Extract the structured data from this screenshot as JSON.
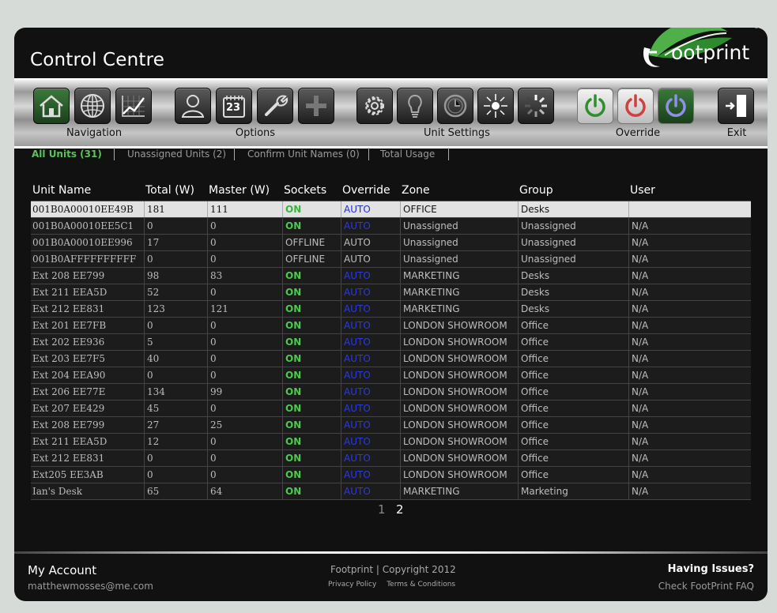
{
  "header": {
    "title": "Control Centre",
    "logo_text": "ootprint"
  },
  "toolbar": {
    "groups": [
      {
        "label": "Navigation"
      },
      {
        "label": "Options",
        "calendar_day": "23"
      },
      {
        "label": "Unit Settings"
      },
      {
        "label": "Override"
      },
      {
        "label": "Exit"
      }
    ]
  },
  "tabs": [
    {
      "label": "All Units (31)"
    },
    {
      "label": "Unassigned Units (2)"
    },
    {
      "label": "Confirm Unit Names (0)"
    },
    {
      "label": "Total Usage"
    }
  ],
  "table": {
    "columns": [
      "Unit Name",
      "Total (W)",
      "Master (W)",
      "Sockets",
      "Override",
      "Zone",
      "Group",
      "User"
    ],
    "rows": [
      [
        "001B0A00010EE49B",
        "181",
        "111",
        "ON",
        "AUTO",
        "OFFICE",
        "Desks",
        ""
      ],
      [
        "001B0A00010EE5C1",
        "0",
        "0",
        "ON",
        "AUTO",
        "Unassigned",
        "Unassigned",
        "N/A"
      ],
      [
        "001B0A00010EE996",
        "17",
        "0",
        "OFFLINE",
        "AUTO",
        "Unassigned",
        "Unassigned",
        "N/A"
      ],
      [
        "001B0AFFFFFFFFFF",
        "0",
        "0",
        "OFFLINE",
        "AUTO",
        "Unassigned",
        "Unassigned",
        "N/A"
      ],
      [
        "Ext 208 EE799",
        "98",
        "83",
        "ON",
        "AUTO",
        "MARKETING",
        "Desks",
        "N/A"
      ],
      [
        "Ext 211 EEA5D",
        "52",
        "0",
        "ON",
        "AUTO",
        "MARKETING",
        "Desks",
        "N/A"
      ],
      [
        "Ext 212 EE831",
        "123",
        "121",
        "ON",
        "AUTO",
        "MARKETING",
        "Desks",
        "N/A"
      ],
      [
        "Ext 201 EE7FB",
        "0",
        "0",
        "ON",
        "AUTO",
        "LONDON SHOWROOM",
        "Office",
        "N/A"
      ],
      [
        "Ext 202 EE936",
        "5",
        "0",
        "ON",
        "AUTO",
        "LONDON SHOWROOM",
        "Office",
        "N/A"
      ],
      [
        "Ext 203 EE7F5",
        "40",
        "0",
        "ON",
        "AUTO",
        "LONDON SHOWROOM",
        "Office",
        "N/A"
      ],
      [
        "Ext 204 EEA90",
        "0",
        "0",
        "ON",
        "AUTO",
        "LONDON SHOWROOM",
        "Office",
        "N/A"
      ],
      [
        "Ext 206 EE77E",
        "134",
        "99",
        "ON",
        "AUTO",
        "LONDON SHOWROOM",
        "Office",
        "N/A"
      ],
      [
        "Ext 207 EE429",
        "45",
        "0",
        "ON",
        "AUTO",
        "LONDON SHOWROOM",
        "Office",
        "N/A"
      ],
      [
        "Ext 208 EE799",
        "27",
        "25",
        "ON",
        "AUTO",
        "LONDON SHOWROOM",
        "Office",
        "N/A"
      ],
      [
        "Ext 211 EEA5D",
        "12",
        "0",
        "ON",
        "AUTO",
        "LONDON SHOWROOM",
        "Office",
        "N/A"
      ],
      [
        "Ext 212 EE831",
        "0",
        "0",
        "ON",
        "AUTO",
        "LONDON SHOWROOM",
        "Office",
        "N/A"
      ],
      [
        "Ext205 EE3AB",
        "0",
        "0",
        "ON",
        "AUTO",
        "LONDON SHOWROOM",
        "Office",
        "N/A"
      ],
      [
        "Ian's Desk",
        "65",
        "64",
        "ON",
        "AUTO",
        "MARKETING",
        "Marketing",
        "N/A"
      ]
    ]
  },
  "pager": {
    "pages": [
      "1",
      "2"
    ]
  },
  "footer": {
    "account_title": "My Account",
    "account_email": "matthewmosses@me.com",
    "copyright": "Footprint | Copyright 2012",
    "privacy": "Privacy Policy",
    "terms": "Terms & Conditions",
    "issues_title": "Having Issues?",
    "faq": "Check FootPrint FAQ"
  },
  "colors": {
    "accent_green": "#5ec15e",
    "on_green": "#4ec84e",
    "auto_blue": "#2a3ae0",
    "background": "#111111"
  }
}
